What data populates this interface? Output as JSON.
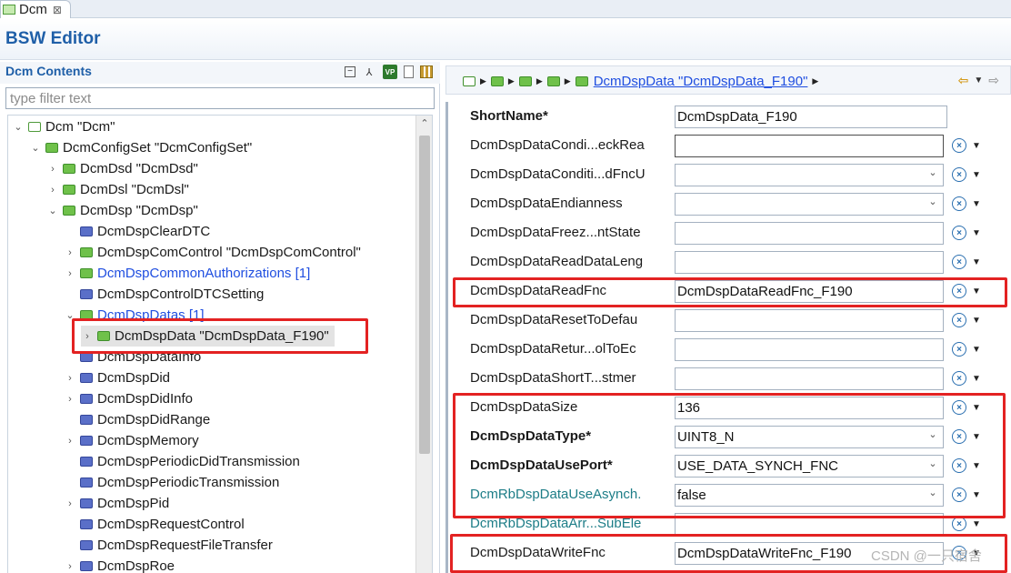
{
  "tab": {
    "title": "Dcm",
    "close": "⊠"
  },
  "editor": {
    "title": "BSW Editor"
  },
  "left": {
    "title": "Dcm Contents",
    "filter_placeholder": "type filter text",
    "tree": [
      {
        "arrow": "⌄",
        "icon": "root",
        "label": "Dcm \"Dcm\"",
        "level": 0
      },
      {
        "arrow": "⌄",
        "icon": "green",
        "label": "DcmConfigSet \"DcmConfigSet\"",
        "level": 1
      },
      {
        "arrow": "›",
        "icon": "green",
        "label": "DcmDsd \"DcmDsd\"",
        "level": 2
      },
      {
        "arrow": "›",
        "icon": "green",
        "label": "DcmDsl \"DcmDsl\"",
        "level": 2
      },
      {
        "arrow": "⌄",
        "icon": "green",
        "label": "DcmDsp \"DcmDsp\"",
        "level": 2
      },
      {
        "arrow": "",
        "icon": "blue",
        "label": "DcmDspClearDTC",
        "level": 3
      },
      {
        "arrow": "›",
        "icon": "green",
        "label": "DcmDspComControl \"DcmDspComControl\"",
        "level": 3
      },
      {
        "arrow": "›",
        "icon": "green",
        "label": "DcmDspCommonAuthorizations [1]",
        "level": 3,
        "link": true
      },
      {
        "arrow": "",
        "icon": "blue",
        "label": "DcmDspControlDTCSetting",
        "level": 3
      },
      {
        "arrow": "⌄",
        "icon": "green",
        "label": "DcmDspDatas [1]",
        "level": 3,
        "link": true
      },
      {
        "arrow": "›",
        "icon": "green",
        "label": "DcmDspData \"DcmDspData_F190\"",
        "level": 4,
        "selected": true
      },
      {
        "arrow": "",
        "icon": "blue",
        "label": "DcmDspDataInfo",
        "level": 3
      },
      {
        "arrow": "›",
        "icon": "blue",
        "label": "DcmDspDid",
        "level": 3
      },
      {
        "arrow": "›",
        "icon": "blue",
        "label": "DcmDspDidInfo",
        "level": 3
      },
      {
        "arrow": "",
        "icon": "blue",
        "label": "DcmDspDidRange",
        "level": 3
      },
      {
        "arrow": "›",
        "icon": "blue",
        "label": "DcmDspMemory",
        "level": 3
      },
      {
        "arrow": "",
        "icon": "blue",
        "label": "DcmDspPeriodicDidTransmission",
        "level": 3
      },
      {
        "arrow": "",
        "icon": "blue",
        "label": "DcmDspPeriodicTransmission",
        "level": 3
      },
      {
        "arrow": "›",
        "icon": "blue",
        "label": "DcmDspPid",
        "level": 3
      },
      {
        "arrow": "",
        "icon": "blue",
        "label": "DcmDspRequestControl",
        "level": 3
      },
      {
        "arrow": "",
        "icon": "blue",
        "label": "DcmDspRequestFileTransfer",
        "level": 3
      },
      {
        "arrow": "›",
        "icon": "blue",
        "label": "DcmDspRoe",
        "level": 3
      }
    ]
  },
  "right": {
    "breadcrumb_link": "DcmDspData \"DcmDspData_F190\"",
    "fields": [
      {
        "label": "ShortName*",
        "style": "bold",
        "value": "DcmDspData_F190",
        "type": "text-short",
        "ctrl": false
      },
      {
        "label": "DcmDspDataCondi...eckRea",
        "style": "",
        "value": "",
        "type": "text-focused",
        "ctrl": true
      },
      {
        "label": "DcmDspDataConditi...dFncU",
        "style": "",
        "value": "",
        "type": "combo",
        "ctrl": true
      },
      {
        "label": "DcmDspDataEndianness",
        "style": "",
        "value": "",
        "type": "combo",
        "ctrl": true
      },
      {
        "label": "DcmDspDataFreez...ntState",
        "style": "",
        "value": "",
        "type": "text",
        "ctrl": true
      },
      {
        "label": "DcmDspDataReadDataLeng",
        "style": "",
        "value": "",
        "type": "text",
        "ctrl": true
      },
      {
        "label": "DcmDspDataReadFnc",
        "style": "",
        "value": "DcmDspDataReadFnc_F190",
        "type": "text",
        "ctrl": true
      },
      {
        "label": "DcmDspDataResetToDefau",
        "style": "",
        "value": "",
        "type": "text",
        "ctrl": true
      },
      {
        "label": "DcmDspDataRetur...olToEc",
        "style": "",
        "value": "",
        "type": "text",
        "ctrl": true
      },
      {
        "label": "DcmDspDataShortT...stmer",
        "style": "",
        "value": "",
        "type": "text",
        "ctrl": true
      },
      {
        "label": "DcmDspDataSize",
        "style": "",
        "value": "136",
        "type": "text",
        "ctrl": true
      },
      {
        "label": "DcmDspDataType*",
        "style": "bold",
        "value": "UINT8_N",
        "type": "combo",
        "ctrl": true
      },
      {
        "label": "DcmDspDataUsePort*",
        "style": "bold",
        "value": "USE_DATA_SYNCH_FNC",
        "type": "combo",
        "ctrl": true
      },
      {
        "label": "DcmRbDspDataUseAsynch.",
        "style": "teal",
        "value": "false",
        "type": "combo",
        "ctrl": true
      },
      {
        "label": "DcmRbDspDataArr...SubEle",
        "style": "teal",
        "value": "",
        "type": "text",
        "ctrl": true
      },
      {
        "label": "DcmDspDataWriteFnc",
        "style": "",
        "value": "DcmDspDataWriteFnc_F190",
        "type": "text",
        "ctrl": true
      }
    ]
  },
  "watermark": "CSDN @一只宿舍"
}
